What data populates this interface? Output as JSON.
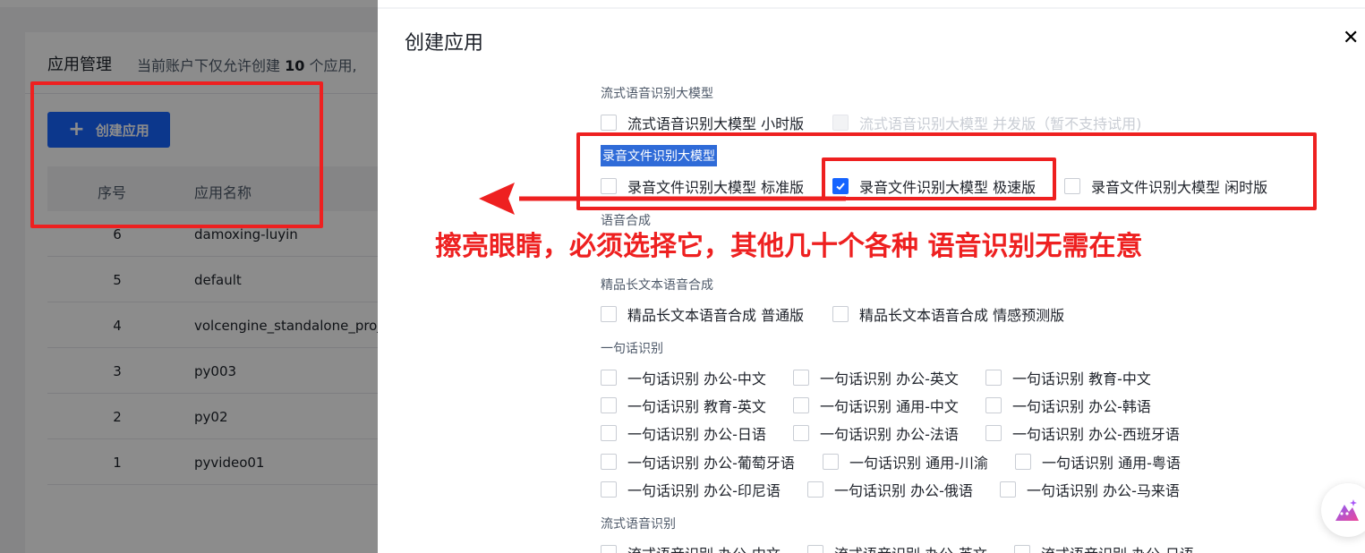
{
  "background": {
    "title": "应用管理",
    "note_prefix": "当前账户下仅允许创建 ",
    "note_count": "10",
    "note_suffix": " 个应用,",
    "create_button": "创建应用",
    "table": {
      "headers": [
        "序号",
        "应用名称"
      ],
      "rows": [
        {
          "no": "6",
          "name": "damoxing-luyin"
        },
        {
          "no": "5",
          "name": "default"
        },
        {
          "no": "4",
          "name": "volcengine_standalone_proje"
        },
        {
          "no": "3",
          "name": "py003"
        },
        {
          "no": "2",
          "name": "py02"
        },
        {
          "no": "1",
          "name": "pyvideo01"
        }
      ]
    }
  },
  "drawer": {
    "title": "创建应用",
    "close_icon": "close-icon",
    "groups": {
      "streaming_llm": {
        "label": "流式语音识别大模型",
        "options": [
          "流式语音识别大模型 小时版",
          "流式语音识别大模型 并发版（暂不支持试用)"
        ]
      },
      "file_llm": {
        "label": "录音文件识别大模型",
        "options": [
          "录音文件识别大模型 标准版",
          "录音文件识别大模型 极速版",
          "录音文件识别大模型 闲时版"
        ]
      },
      "tts": {
        "label": "语音合成"
      },
      "long_tts": {
        "label": "精品长文本语音合成",
        "options": [
          "精品长文本语音合成 普通版",
          "精品长文本语音合成 情感预测版"
        ]
      },
      "sentence": {
        "label": "一句话识别",
        "options": [
          "一句话识别 办公-中文",
          "一句话识别 办公-英文",
          "一句话识别 教育-中文",
          "一句话识别 教育-英文",
          "一句话识别 通用-中文",
          "一句话识别 办公-韩语",
          "一句话识别 办公-日语",
          "一句话识别 办公-法语",
          "一句话识别 办公-西班牙语",
          "一句话识别 办公-葡萄牙语",
          "一句话识别 通用-川渝",
          "一句话识别 通用-粤语",
          "一句话识别 办公-印尼语",
          "一句话识别 办公-俄语",
          "一句话识别 办公-马来语"
        ]
      },
      "streaming": {
        "label": "流式语音识别",
        "options": [
          "流式语音识别 办公-中文",
          "流式语音识别 办公-英文",
          "流式语音识别 办公-日语"
        ]
      }
    },
    "checked_option": "录音文件识别大模型 极速版"
  },
  "annotation": {
    "text": "擦亮眼睛，必须选择它，其他几十个各种 语音识别无需在意"
  },
  "colors": {
    "primary": "#1664ff",
    "annotation": "#ee2020",
    "highlight": "#2f6bd8"
  }
}
